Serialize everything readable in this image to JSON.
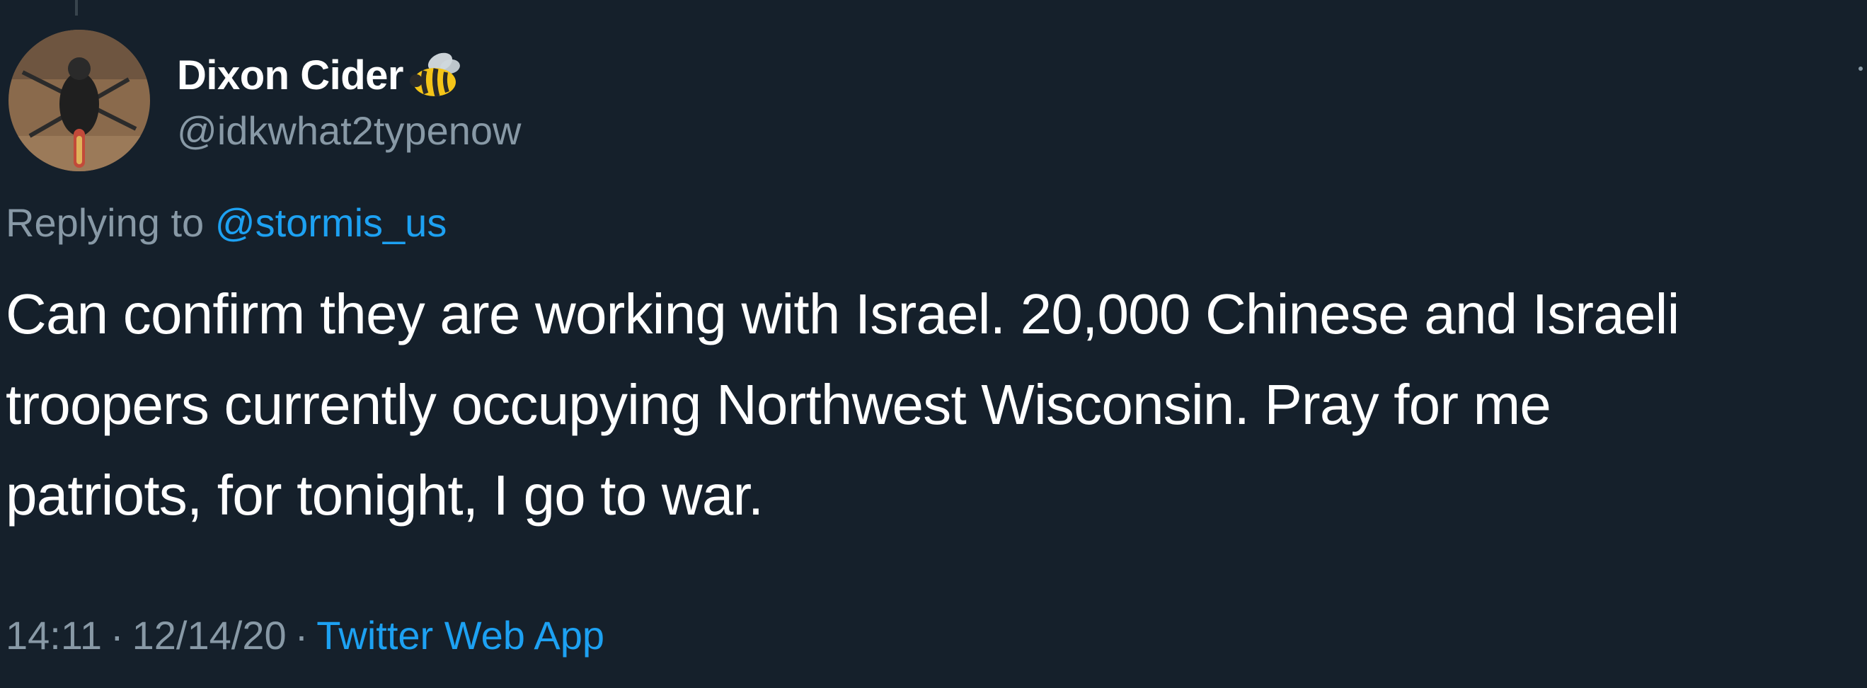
{
  "author": {
    "display_name": "Dixon Cider",
    "handle": "@idkwhat2typenow",
    "avatar_icon": "avatar-photo",
    "badge_icon": "bee-emoji-icon"
  },
  "reply": {
    "prefix": "Replying to",
    "mention": "@stormis_us"
  },
  "tweet": {
    "lines": [
      "Can confirm they are working with Israel. 20,000 Chinese and Israeli",
      "troopers currently occupying Northwest Wisconsin. Pray for me",
      "patriots, for tonight, I go to war."
    ]
  },
  "meta": {
    "time": "14:11",
    "separator": "·",
    "date": "12/14/20",
    "source": "Twitter Web App"
  },
  "colors": {
    "background": "#15202b",
    "primary_text": "#ffffff",
    "secondary_text": "#8899a6",
    "link": "#1da1f2"
  }
}
